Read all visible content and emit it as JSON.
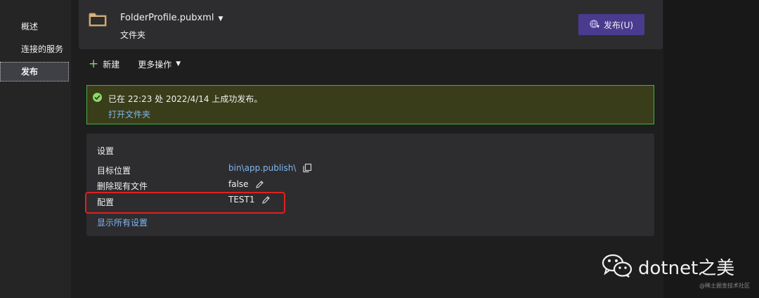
{
  "sidebar": {
    "items": [
      {
        "label": "概述",
        "active": false
      },
      {
        "label": "连接的服务",
        "active": false
      },
      {
        "label": "发布",
        "active": true
      }
    ]
  },
  "profile": {
    "name": "FolderProfile.pubxml",
    "type": "文件夹",
    "publish_button": "发布(U)"
  },
  "toolbar": {
    "new_label": "新建",
    "more_label": "更多操作"
  },
  "status": {
    "message": "已在 22:23 处 2022/4/14 上成功发布。",
    "open_folder_link": "打开文件夹"
  },
  "settings": {
    "title": "设置",
    "rows": [
      {
        "label": "目标位置",
        "value": "bin\\app.publish\\",
        "is_link": true,
        "action_icon": "copy-icon"
      },
      {
        "label": "删除现有文件",
        "value": "false",
        "is_link": false,
        "action_icon": "pencil-icon"
      },
      {
        "label": "配置",
        "value": "TEST1",
        "is_link": false,
        "action_icon": "pencil-icon",
        "highlighted": true
      }
    ],
    "show_all_link": "显示所有设置"
  },
  "watermark": {
    "text": "dotnet之美",
    "icon": "wechat-icon",
    "credit": "@稀土掘金技术社区"
  },
  "colors": {
    "background": "#1e1e1e",
    "card": "#2d2d30",
    "accent_purple": "#4b3b8f",
    "success_border": "#4caf3f",
    "success_bg": "#393d19",
    "link": "#83b6ee",
    "highlight_red": "#e0201e"
  }
}
